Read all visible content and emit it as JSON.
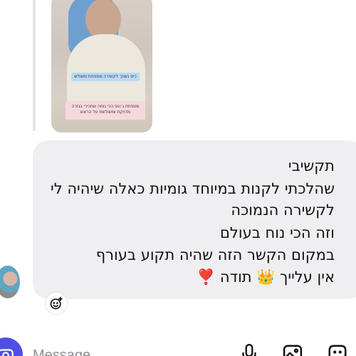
{
  "story": {
    "caption_top": "כיס נשפך לקשירה מספחת משולש",
    "caption_bottom": "מטפחת ג׳ונס הכי נוחה שתכירי בגזרה מדויקת ומשולשת על הראש"
  },
  "message": {
    "lines": [
      "תקשיבי",
      "שהלכתי לקנות במיוחד גומיות כאלה שיהיה לי",
      "לקשירה הנמוכה",
      "וזה הכי נוח בעולם",
      "במקום הקשר הזה שהיה תקוע בעורף",
      "אין עלייך 👑 תודה ❣️"
    ]
  },
  "composer": {
    "placeholder": "Message"
  },
  "icons": {
    "react": "add-reaction-icon",
    "camera": "camera-icon",
    "mic": "microphone-icon",
    "gallery": "gallery-icon",
    "sticker": "sticker-icon"
  },
  "colors": {
    "bubble": "#efeff1",
    "camera_button": "#4f4fe6",
    "icon": "#111111"
  }
}
